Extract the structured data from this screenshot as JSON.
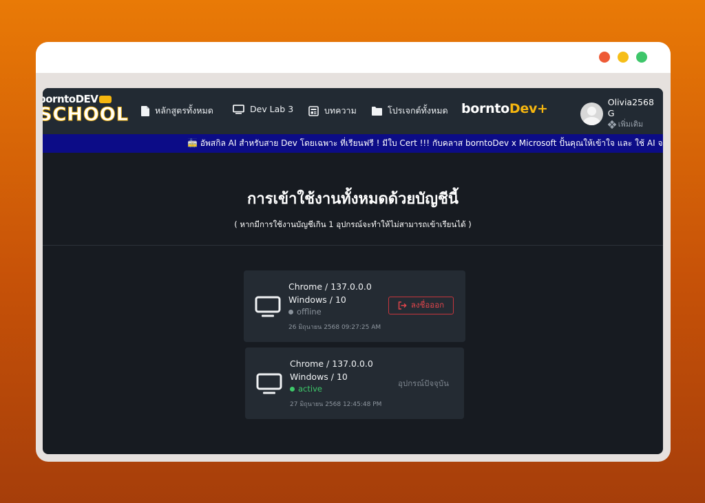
{
  "window": {
    "dots": [
      "#ee5a36",
      "#f6be18",
      "#3ec66a"
    ]
  },
  "nav": {
    "logo_top": "borntoDEV",
    "logo_bottom": "SCHOOL",
    "items": [
      {
        "label": "หลักสูตรทั้งหมด",
        "icon": "document-icon"
      },
      {
        "label": "Dev Lab 3",
        "icon": "monitor-icon"
      },
      {
        "label": "บทความ",
        "icon": "article-icon"
      },
      {
        "label": "โปรเจกต์ทั้งหมด",
        "icon": "folder-icon"
      }
    ],
    "brand_a": "bornto",
    "brand_b": "Dev+",
    "user_name": "Olivia2568 G",
    "user_more": "เพิ่มเติม"
  },
  "banner": {
    "text": "🚋 อัพสกิล AI สำหรับสาย Dev โดยเฉพาะ ที่เรียนฟรี ! มีใบ Cert !!! กับคลาส borntoDev x Microsoft ปั้นคุณให้เข้าใจ และ ใช้ AI จนเป็น"
  },
  "page": {
    "title": "การเข้าใช้งานทั้งหมดด้วยบัญชีนี้",
    "subtitle": "( หากมีการใช้งานบัญชีเกิน 1 อุปกรณ์จะทำให้ไม่สามารถเข้าเรียนได้ )"
  },
  "sessions": [
    {
      "browser": "Chrome / 137.0.0.0",
      "os": "Windows / 10",
      "status": "offline",
      "status_color": "#8a929b",
      "date": "26 มิถุนายน 2568 09:27:25 AM",
      "action": "ลงชื่อออก"
    },
    {
      "browser": "Chrome / 137.0.0.0",
      "os": "Windows / 10",
      "status": "active",
      "status_color": "#3ec96a",
      "date": "27 มิถุนายน 2568 12:45:48 PM",
      "current_label": "อุปกรณ์ปัจจุบัน"
    }
  ]
}
